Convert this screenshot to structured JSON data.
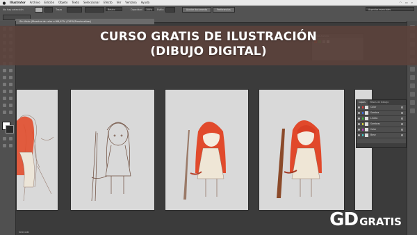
{
  "menubar": {
    "items": [
      "Illustrator",
      "Archivo",
      "Edición",
      "Objeto",
      "Texto",
      "Seleccionar",
      "Efecto",
      "Ver",
      "Ventana",
      "Ayuda"
    ]
  },
  "controlbar": {
    "selection_label": "No hay selección",
    "stroke_label": "Trazo",
    "brush_label": "Básico",
    "opacity_label": "Opacidad",
    "opacity_value": "100%",
    "style_label": "Estilo",
    "doc_setup_button": "Ajustar documento",
    "preferences_button": "Preferencias",
    "workspace_label": "Aspectos esenciales"
  },
  "document": {
    "tab_title": "Sin título (Muestra de color al 66,67% (CMYK/Previsualizar)"
  },
  "banner": {
    "line1": "CURSO GRATIS DE ILUSTRACIÓN",
    "line2": "(DIBUJO DIGITAL)"
  },
  "swatches_panel": {
    "title": "Tema Archivo"
  },
  "layers_panel": {
    "tabs": [
      "Capas",
      "Mesas de trabajo"
    ],
    "layers": [
      {
        "name": "Color",
        "color": "#e23a3a"
      },
      {
        "name": "Sombra",
        "color": "#3a6ee2"
      },
      {
        "name": "Lineas",
        "color": "#3ac03a"
      },
      {
        "name": "Sombras",
        "color": "#d0d03a"
      },
      {
        "name": "Color",
        "color": "#c03ac0"
      },
      {
        "name": "Base",
        "color": "#3ac0c0"
      }
    ]
  },
  "statusbar": {
    "text": "Selección"
  },
  "logo": {
    "gd": "GD",
    "gratis": "GRATIS"
  },
  "colors": {
    "banner": "#5c423c",
    "hair": "#e04a2c",
    "sketch": "#6b4a3a"
  }
}
